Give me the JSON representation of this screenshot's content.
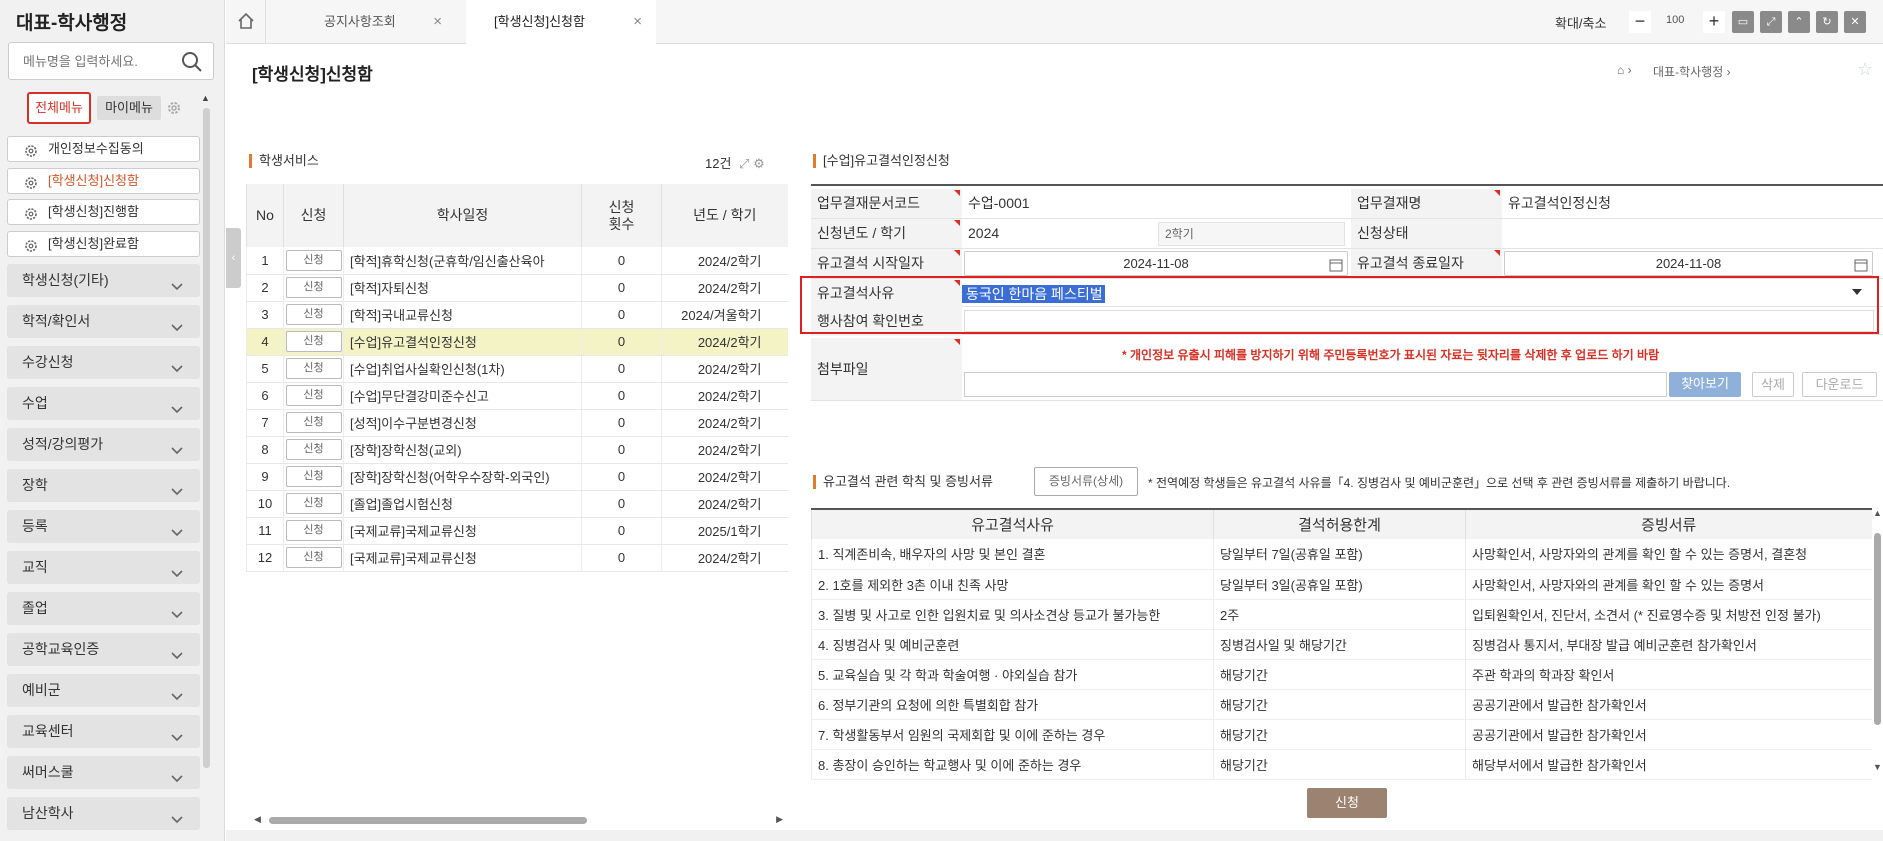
{
  "sidebar": {
    "title": "대표-학사행정",
    "search_placeholder": "메뉴명을 입력하세요.",
    "tab_all": "전체메뉴",
    "tab_my": "마이메뉴",
    "favorites": [
      {
        "label": "개인정보수집동의"
      },
      {
        "label": "[학생신청]신청함",
        "active": true
      },
      {
        "label": "[학생신청]진행함"
      },
      {
        "label": "[학생신청]완료함"
      }
    ],
    "categories": [
      "학생신청(기타)",
      "학적/확인서",
      "수강신청",
      "수업",
      "성적/강의평가",
      "장학",
      "등록",
      "교직",
      "졸업",
      "공학교육인증",
      "예비군",
      "교육센터",
      "써머스쿨",
      "남산학사"
    ]
  },
  "tabs": [
    {
      "label": "공지사항조회"
    },
    {
      "label": "[학생신청]신청함",
      "active": true
    }
  ],
  "zoom": {
    "label": "확대/축소",
    "value": "100"
  },
  "page": {
    "title": "[학생신청]신청함",
    "breadcrumb": [
      "대표-학사행정"
    ]
  },
  "service": {
    "title": "학생서비스",
    "count": "12건",
    "columns": [
      "No",
      "신청",
      "학사일정",
      "신청\n횟수",
      "년도 / 학기"
    ],
    "button_label": "신청",
    "rows": [
      {
        "no": "1",
        "name": "[학적]휴학신청(군휴학/임신출산육아",
        "cnt": "0",
        "term": "2024/2학기"
      },
      {
        "no": "2",
        "name": "[학적]자퇴신청",
        "cnt": "0",
        "term": "2024/2학기"
      },
      {
        "no": "3",
        "name": "[학적]국내교류신청",
        "cnt": "0",
        "term": "2024/겨울학기"
      },
      {
        "no": "4",
        "name": "[수업]유고결석인정신청",
        "cnt": "0",
        "term": "2024/2학기",
        "selected": true
      },
      {
        "no": "5",
        "name": "[수업]취업사실확인신청(1차)",
        "cnt": "0",
        "term": "2024/2학기"
      },
      {
        "no": "6",
        "name": "[수업]무단결강미준수신고",
        "cnt": "0",
        "term": "2024/2학기"
      },
      {
        "no": "7",
        "name": "[성적]이수구분변경신청",
        "cnt": "0",
        "term": "2024/2학기"
      },
      {
        "no": "8",
        "name": "[장학]장학신청(교외)",
        "cnt": "0",
        "term": "2024/2학기"
      },
      {
        "no": "9",
        "name": "[장학]장학신청(어학우수장학-외국인)",
        "cnt": "0",
        "term": "2024/2학기"
      },
      {
        "no": "10",
        "name": "[졸업]졸업시험신청",
        "cnt": "0",
        "term": "2024/2학기"
      },
      {
        "no": "11",
        "name": "[국제교류]국제교류신청",
        "cnt": "0",
        "term": "2025/1학기"
      },
      {
        "no": "12",
        "name": "[국제교류]국제교류신청",
        "cnt": "0",
        "term": "2024/2학기"
      }
    ]
  },
  "form": {
    "title": "[수업]유고결석인정신청",
    "doc_code_label": "업무결재문서코드",
    "doc_code": "수업-0001",
    "doc_name_label": "업무결재명",
    "doc_name": "유고결석인정신청",
    "year_label": "신청년도 / 학기",
    "year": "2024",
    "semester": "2학기",
    "status_label": "신청상태",
    "start_label": "유고결석 시작일자",
    "start_date": "2024-11-08",
    "end_label": "유고결석 종료일자",
    "end_date": "2024-11-08",
    "reason_label": "유고결석사유",
    "reason_value": "동국인 한마음 페스티벌",
    "event_label": "행사참여 확인번호",
    "attach_label": "첨부파일",
    "attach_warning": "* 개인정보 유출시 피해를 방지하기 위해 주민등록번호가 표시된 자료는 뒷자리를 삭제한 후 업로드 하기 바람",
    "btn_find": "찾아보기",
    "btn_delete": "삭제",
    "btn_download": "다운로드"
  },
  "reasons": {
    "title": "유고결석 관련 학칙 및 증빙서류",
    "doc_button": "증빙서류(상세)",
    "note": "* 전역예정 학생들은 유고결석 사유를「4. 징병검사 및 예비군훈련」으로 선택 후 관련 증빙서류를 제출하기 바랍니다.",
    "columns": [
      "유고결석사유",
      "결석허용한계",
      "증빙서류"
    ],
    "rows": [
      {
        "reason": "1. 직계존비속, 배우자의 사망 및 본인 결혼",
        "limit": "당일부터 7일(공휴일 포함)",
        "doc": "사망확인서, 사망자와의 관계를 확인 할 수 있는 증명서, 결혼청"
      },
      {
        "reason": "2. 1호를 제외한 3촌 이내 친족 사망",
        "limit": "당일부터 3일(공휴일 포함)",
        "doc": "사망확인서, 사망자와의 관계를 확인 할 수 있는 증명서"
      },
      {
        "reason": "3. 질병 및 사고로 인한 입원치료 및 의사소견상 등교가 불가능한",
        "limit": "2주",
        "doc": "입퇴원확인서, 진단서, 소견서 (* 진료영수증 및 처방전 인정 불가)"
      },
      {
        "reason": "4. 징병검사 및 예비군훈련",
        "limit": "징병검사일 및 해당기간",
        "doc": "징병검사 통지서, 부대장 발급 예비군훈련 참가확인서"
      },
      {
        "reason": "5. 교육실습 및 각 학과 학술여행 · 야외실습 참가",
        "limit": "해당기간",
        "doc": "주관 학과의 학과장 확인서"
      },
      {
        "reason": "6. 정부기관의 요청에 의한 특별회합 참가",
        "limit": "해당기간",
        "doc": "공공기관에서 발급한 참가확인서"
      },
      {
        "reason": "7. 학생활동부서 임원의 국제회합 및 이에 준하는 경우",
        "limit": "해당기간",
        "doc": "공공기관에서 발급한 참가확인서"
      },
      {
        "reason": "8. 총장이 승인하는 학교행사 및 이에 준하는 경우",
        "limit": "해당기간",
        "doc": "해당부서에서 발급한 참가확인서"
      }
    ]
  },
  "submit_label": "신청"
}
